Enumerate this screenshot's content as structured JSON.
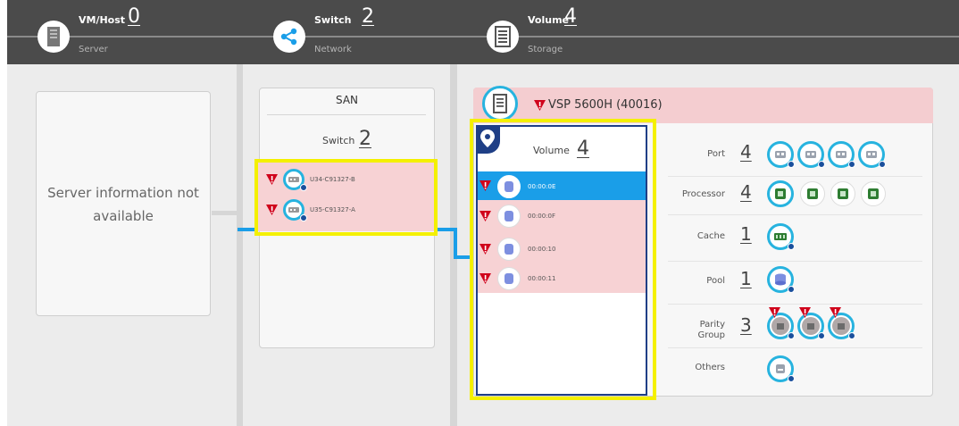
{
  "header": {
    "groups": [
      {
        "title": "VM/Host",
        "count": "0",
        "subtitle": "Server",
        "icon": "server-icon"
      },
      {
        "title": "Switch",
        "count": "2",
        "subtitle": "Network",
        "icon": "share-icon"
      },
      {
        "title": "Volume",
        "count": "4",
        "subtitle": "Storage",
        "icon": "storage-icon"
      }
    ]
  },
  "server": {
    "message_line1": "Server information not",
    "message_line2": "available"
  },
  "network": {
    "title": "SAN",
    "switch_label": "Switch",
    "switch_count": "2",
    "switches": [
      {
        "name": "U34-C91327-B",
        "status": "warning"
      },
      {
        "name": "U35-C91327-A",
        "status": "warning"
      }
    ]
  },
  "storage": {
    "name": "VSP 5600H (40016)",
    "status": "warning",
    "volume_label": "Volume",
    "volume_count": "4",
    "volumes": [
      {
        "id": "00:00:0E",
        "selected": true
      },
      {
        "id": "00:00:0F",
        "selected": false
      },
      {
        "id": "00:00:10",
        "selected": false
      },
      {
        "id": "00:00:11",
        "selected": false
      }
    ],
    "resources": [
      {
        "label": "Port",
        "count": "4",
        "icon": "port-icon",
        "items": 4
      },
      {
        "label": "Processor",
        "count": "4",
        "icon": "processor-icon",
        "items": 4
      },
      {
        "label": "Cache",
        "count": "1",
        "icon": "cache-icon",
        "items": 1
      },
      {
        "label": "Pool",
        "count": "1",
        "icon": "pool-icon",
        "items": 1
      },
      {
        "label": "Parity Group",
        "count": "3",
        "icon": "parity-group-icon",
        "items": 3
      },
      {
        "label": "Others",
        "count": "",
        "icon": "others-icon",
        "items": 1
      }
    ]
  },
  "colors": {
    "header_bg": "#4b4b4b",
    "selection": "#1a9ee8",
    "highlight_ring": "#27b3df",
    "alert_row": "#f7d2d4",
    "focus_box": "#f4f000",
    "warning": "#d0021b"
  }
}
